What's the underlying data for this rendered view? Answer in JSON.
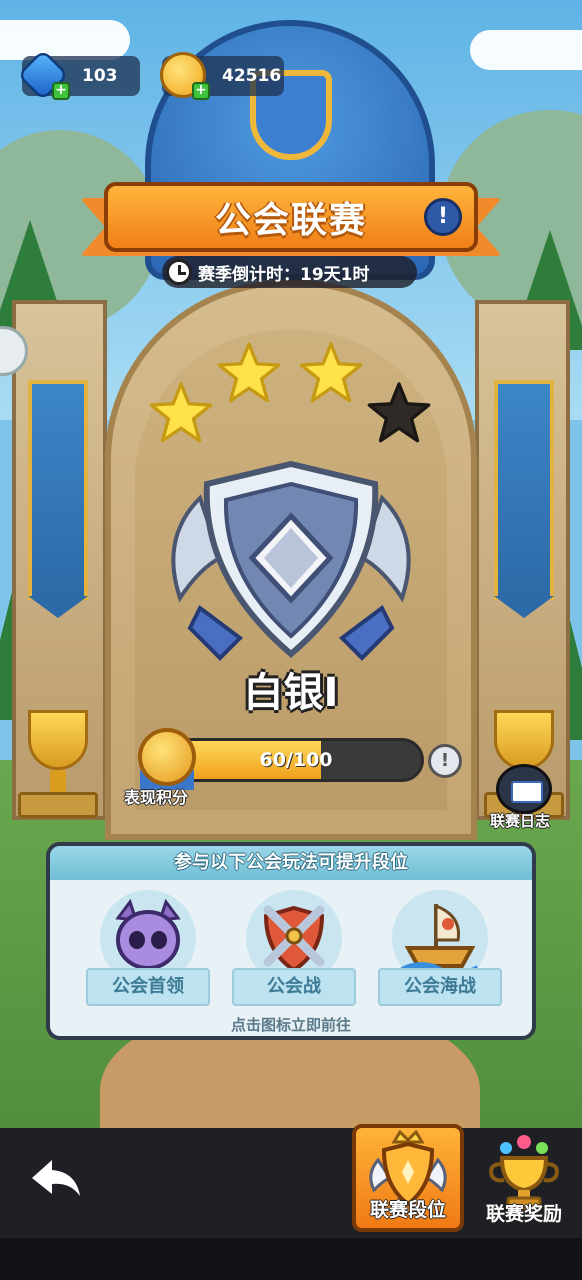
{
  "resources": {
    "gems": "103",
    "coins": "42516"
  },
  "title": "公会联赛",
  "countdown": "赛季倒计时：19天1时",
  "stars": {
    "earned": 3,
    "total": 4
  },
  "rank": "白银I",
  "progress": {
    "text": "60/100",
    "value": 60,
    "max": 100,
    "label": "表现积分"
  },
  "side_button": {
    "label": "联赛日志"
  },
  "panel": {
    "header": "参与以下公会玩法可提升段位",
    "modes": [
      {
        "label": "公会首领",
        "icon": "boss-skull-icon"
      },
      {
        "label": "公会战",
        "icon": "crossed-swords-shield-icon"
      },
      {
        "label": "公会海战",
        "icon": "ship-icon"
      }
    ],
    "footer": "点击图标立即前往"
  },
  "nav": {
    "tabs": [
      {
        "label": "联赛段位",
        "icon": "shield-crown-icon",
        "active": true
      },
      {
        "label": "联赛奖励",
        "icon": "trophy-icon",
        "active": false
      }
    ]
  },
  "colors": {
    "accent": "#f08a2a",
    "star_filled": "#ffe14a",
    "star_empty": "#2f2a25",
    "progress_fill": "#f0a21c"
  }
}
